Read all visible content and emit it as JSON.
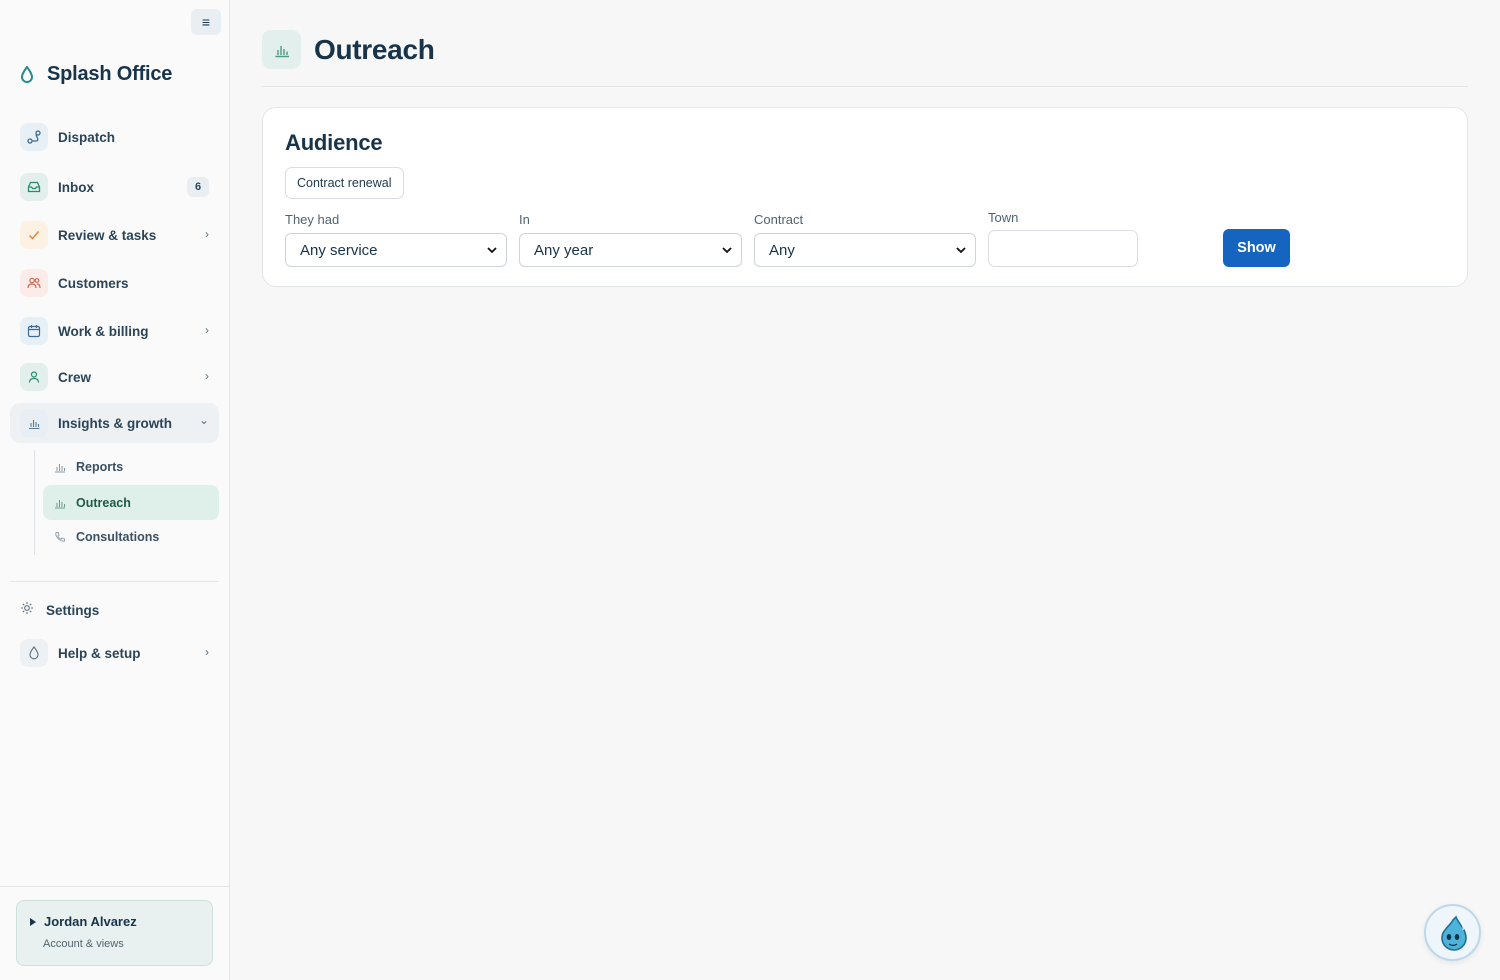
{
  "app": {
    "name": "Splash Office"
  },
  "sidebar": {
    "nav": [
      {
        "label": "Dispatch",
        "icon": "route-icon",
        "color": "#e8f0f7"
      },
      {
        "label": "Inbox",
        "icon": "inbox-icon",
        "badge": "6",
        "color": "#e2efec"
      },
      {
        "label": "Review & tasks",
        "icon": "check-icon",
        "chevron": "›",
        "color": "#fdf1e4"
      },
      {
        "label": "Customers",
        "icon": "users-icon",
        "color": "#fbece9"
      },
      {
        "label": "Work & billing",
        "icon": "calendar-icon",
        "chevron": "›",
        "color": "#e8f0f7"
      },
      {
        "label": "Crew",
        "icon": "person-icon",
        "chevron": "›",
        "color": "#e2efec"
      },
      {
        "label": "Insights & growth",
        "icon": "bar-chart-icon",
        "chevron": "⌄",
        "expanded": true,
        "color": "#e8eef3"
      }
    ],
    "subnav": [
      {
        "label": "Reports",
        "icon": "bar-chart-icon"
      },
      {
        "label": "Outreach",
        "icon": "bar-chart-icon",
        "active": true
      },
      {
        "label": "Consultations",
        "icon": "phone-icon"
      }
    ],
    "settings": {
      "label": "Settings",
      "icon": "gear-icon"
    },
    "help": {
      "label": "Help & setup",
      "icon": "drop-icon",
      "chevron": "›"
    },
    "account": {
      "name": "Jordan Alvarez",
      "subtitle": "Account & views"
    }
  },
  "page": {
    "title": "Outreach"
  },
  "audience": {
    "title": "Audience",
    "chip": "Contract renewal",
    "filters": {
      "they_had": {
        "label": "They had",
        "value": "Any service"
      },
      "in": {
        "label": "In",
        "value": "Any year"
      },
      "contract": {
        "label": "Contract",
        "value": "Any"
      },
      "town": {
        "label": "Town",
        "value": ""
      }
    },
    "show_label": "Show"
  },
  "colors": {
    "accent": "#1565c0",
    "brand_teal": "#2a8c8c",
    "active_bg": "#dff0ea"
  }
}
